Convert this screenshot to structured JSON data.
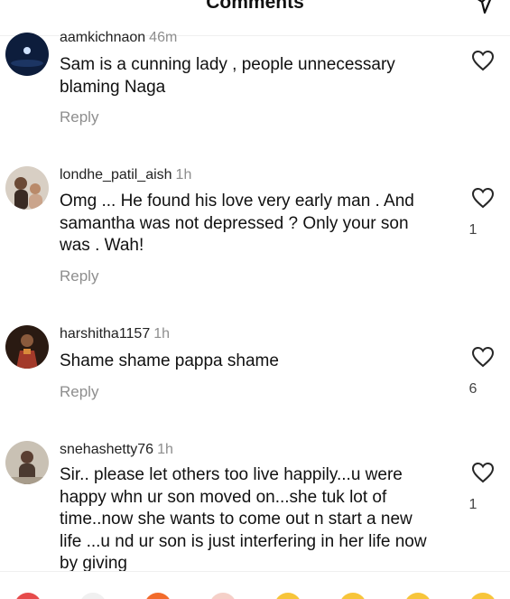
{
  "header": {
    "title": "Comments"
  },
  "comments": [
    {
      "username": "aamkichnaon",
      "time": "46m",
      "text": "Sam is a cunning lady , people unnecessary blaming Naga",
      "reply": "Reply",
      "likes": ""
    },
    {
      "username": "londhe_patil_aish",
      "time": "1h",
      "text": "Omg ... He found his love very early man . And samantha was not depressed ? Only your son was . Wah!",
      "reply": "Reply",
      "likes": "1"
    },
    {
      "username": "harshitha1157",
      "time": "1h",
      "text": "Shame shame pappa shame",
      "reply": "Reply",
      "likes": "6"
    },
    {
      "username": "snehashetty76",
      "time": "1h",
      "text": "Sir.. please let others too live happily...u were happy whn ur son moved on...she tuk lot of time..now she wants to come out n start a new life ...u nd ur son is just interfering in her life now by giving",
      "reply": "",
      "likes": "1"
    }
  ],
  "icons": {
    "share": "share-icon",
    "like": "heart-icon"
  },
  "colors": {
    "text": "#111111",
    "muted": "#8e8e8e",
    "divider": "#efefef"
  }
}
